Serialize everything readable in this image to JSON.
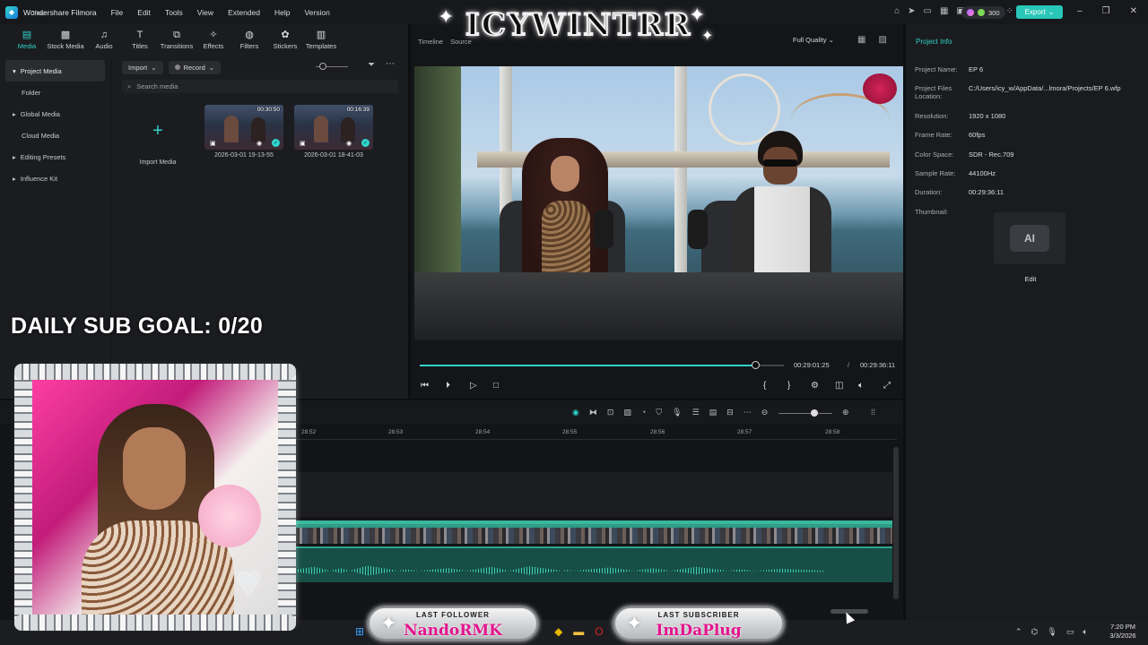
{
  "app": {
    "name": "Wondershare Filmora",
    "menu": [
      "File",
      "Edit",
      "Tools",
      "View",
      "Extended",
      "Help",
      "Version"
    ],
    "credits": "300",
    "export_label": "Export"
  },
  "overlay": {
    "stream_title": "ICYWINTRR",
    "sub_goal": "DAILY SUB GOAL: 0/20",
    "last_follower_label": "LAST FOLLOWER",
    "last_follower_name": "NandoRMK",
    "last_subscriber_label": "LAST SUBSCRIBER",
    "last_subscriber_name": "ImDaPlug",
    "clear_label": "Clear"
  },
  "media": {
    "tabs": [
      {
        "label": "Media",
        "icon": "media-icon"
      },
      {
        "label": "Stock Media",
        "icon": "stock-media-icon"
      },
      {
        "label": "Audio",
        "icon": "audio-icon"
      },
      {
        "label": "Titles",
        "icon": "titles-icon"
      },
      {
        "label": "Transitions",
        "icon": "transitions-icon"
      },
      {
        "label": "Effects",
        "icon": "effects-icon"
      },
      {
        "label": "Filters",
        "icon": "filters-icon"
      },
      {
        "label": "Stickers",
        "icon": "stickers-icon"
      },
      {
        "label": "Templates",
        "icon": "templates-icon"
      }
    ],
    "sidebar": [
      {
        "label": "Project Media",
        "active": true
      },
      {
        "label": "Folder",
        "sub": true
      },
      {
        "label": "Global Media"
      },
      {
        "label": "Cloud Media",
        "sub": true
      },
      {
        "label": "Editing Presets"
      },
      {
        "label": "Influence Kit"
      }
    ],
    "import_label": "Import",
    "record_label": "Record",
    "search_placeholder": "Search media",
    "import_tile_label": "Import Media",
    "clips": [
      {
        "name": "2026-03-01 19-13-55",
        "duration": "00:30:50"
      },
      {
        "name": "2026-03-01 18-41-03",
        "duration": "00:16:39"
      }
    ]
  },
  "preview": {
    "tabs": [
      "Timeline",
      "Source"
    ],
    "quality": "Full Quality",
    "current_time": "00:29:01:25",
    "separator": "/",
    "total_time": "00:29:36:11",
    "progress": 0.93
  },
  "project_info": {
    "title": "Project Info",
    "rows": [
      {
        "label": "Project Name:",
        "value": "EP 6"
      },
      {
        "label": "Project Files Location:",
        "value": "C:/Users/icy_w/AppData/...lmora/Projects/EP 6.wfp"
      },
      {
        "label": "Resolution:",
        "value": "1920 x 1080"
      },
      {
        "label": "Frame Rate:",
        "value": "60fps"
      },
      {
        "label": "Color Space:",
        "value": "SDR - Rec.709"
      },
      {
        "label": "Sample Rate:",
        "value": "44100Hz"
      },
      {
        "label": "Duration:",
        "value": "00:29:36:11"
      },
      {
        "label": "Thumbnail:",
        "value": ""
      }
    ],
    "edit_label": "Edit"
  },
  "timeline": {
    "ticks": [
      "28:52",
      "28:53",
      "28:54",
      "28:55",
      "28:56",
      "28:57",
      "28:58"
    ]
  },
  "taskbar": {
    "time": "7:20 PM",
    "date": "3/3/2026"
  }
}
